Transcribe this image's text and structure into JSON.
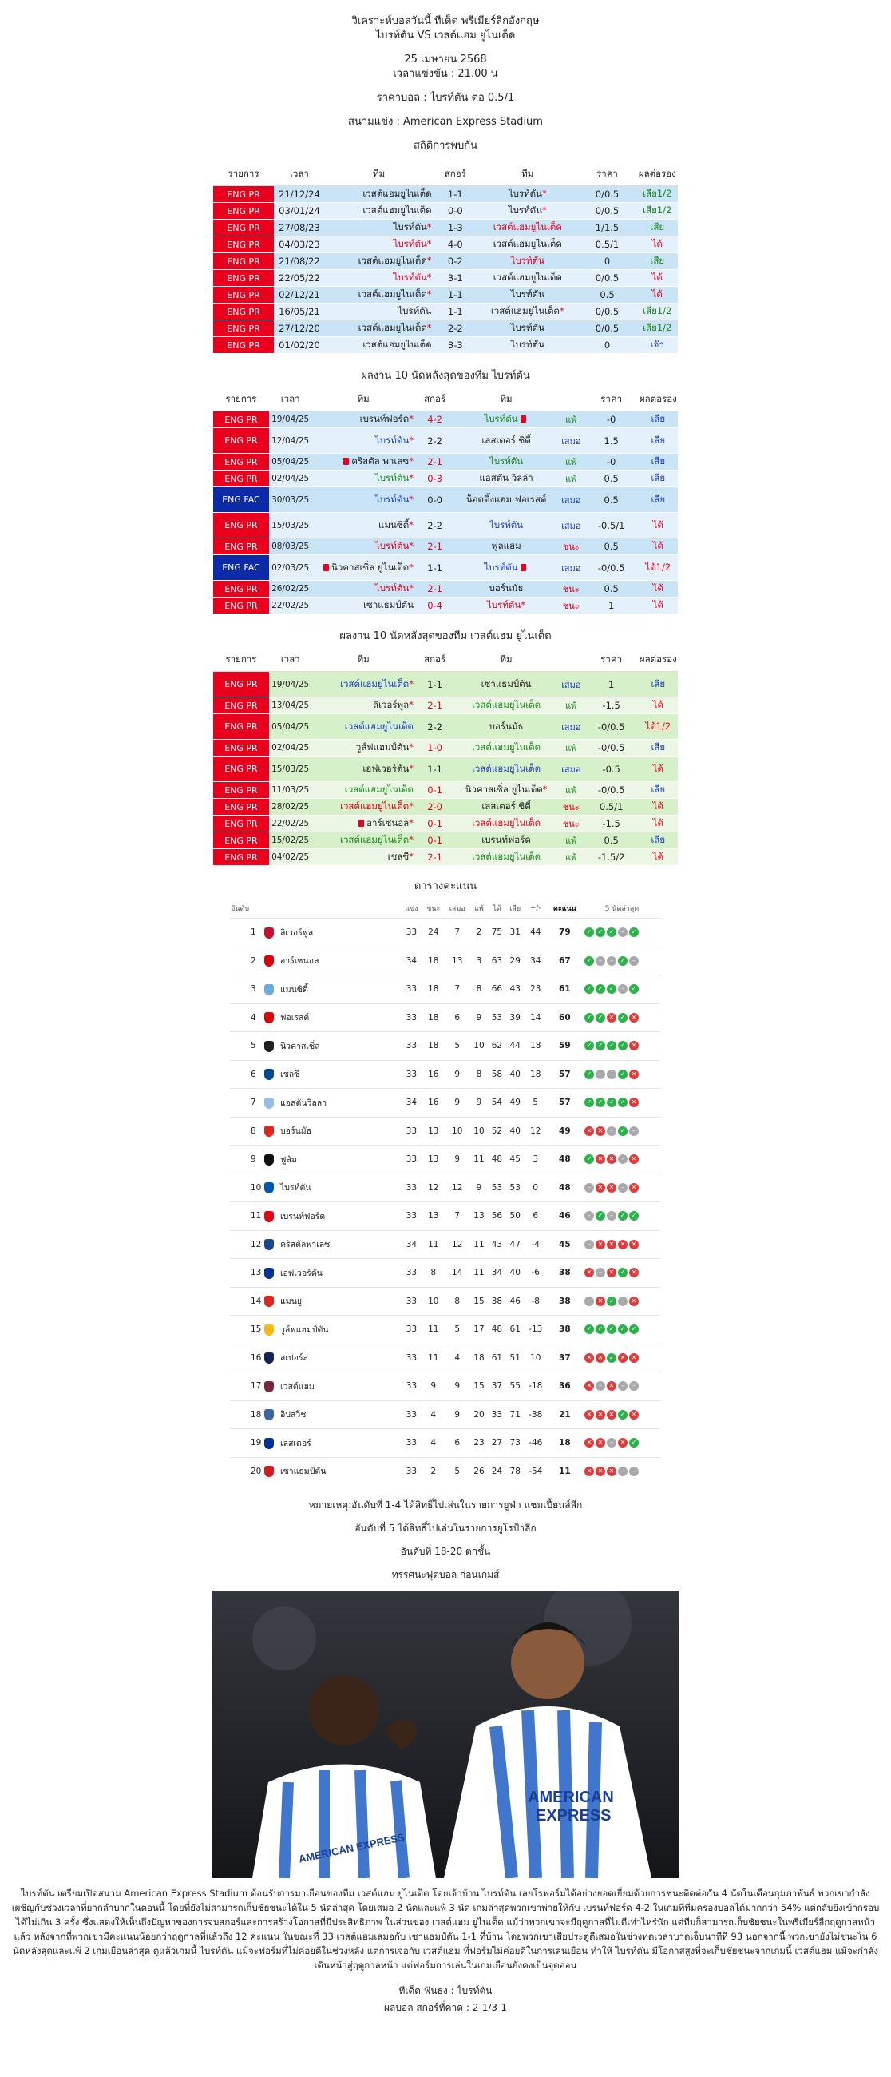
{
  "header": {
    "title1": "วิเคราะห์บอลวันนี้ ทีเด็ด พรีเมียร์ลีกอังกฤษ",
    "title2": "ไบรท์ตัน VS เวสต์แฮม ยูไนเต็ด",
    "date": "25 เมษายน 2568",
    "time": "เวลาแข่งขัน : 21.00 น",
    "odds": "ราคาบอล : ไบรท์ตัน ต่อ 0.5/1",
    "stadium": "สนามแข่ง : American Express Stadium",
    "h2h_title": "สถิติการพบกัน"
  },
  "cols": {
    "league": "รายการ",
    "date": "เวลา",
    "team": "ทีม",
    "score": "สกอร์",
    "price": "ราคา",
    "result": "ผลต่อรอง"
  },
  "h2h": [
    {
      "lg": "ENG PR",
      "d": "21/12/24",
      "h": "เวสต์แฮมยูไนเต็ด",
      "hs": "",
      "s": "1-1",
      "a": "ไบรท์ตัน",
      "as": "*",
      "hc": "",
      "ac": "",
      "p": "0/0.5",
      "r": "เสีย1/2",
      "rc": "green"
    },
    {
      "lg": "ENG PR",
      "d": "03/01/24",
      "h": "เวสต์แฮมยูไนเต็ด",
      "hs": "",
      "s": "0-0",
      "a": "ไบรท์ตัน",
      "as": "*",
      "hc": "",
      "ac": "",
      "p": "0/0.5",
      "r": "เสีย1/2",
      "rc": "green"
    },
    {
      "lg": "ENG PR",
      "d": "27/08/23",
      "h": "ไบรท์ตัน",
      "hs": "*",
      "s": "1-3",
      "a": "เวสต์แฮมยูไนเต็ด",
      "as": "",
      "hc": "",
      "ac": "red",
      "p": "1/1.5",
      "r": "เสีย",
      "rc": "green"
    },
    {
      "lg": "ENG PR",
      "d": "04/03/23",
      "h": "ไบรท์ตัน",
      "hs": "*",
      "s": "4-0",
      "a": "เวสต์แฮมยูไนเต็ด",
      "as": "",
      "hc": "red",
      "ac": "",
      "p": "0.5/1",
      "r": "ได้",
      "rc": "red"
    },
    {
      "lg": "ENG PR",
      "d": "21/08/22",
      "h": "เวสต์แฮมยูไนเต็ด",
      "hs": "*",
      "s": "0-2",
      "a": "ไบรท์ตัน",
      "as": "",
      "hc": "",
      "ac": "red",
      "p": "0",
      "r": "เสีย",
      "rc": "green"
    },
    {
      "lg": "ENG PR",
      "d": "22/05/22",
      "h": "ไบรท์ตัน",
      "hs": "*",
      "s": "3-1",
      "a": "เวสต์แฮมยูไนเต็ด",
      "as": "",
      "hc": "red",
      "ac": "",
      "p": "0/0.5",
      "r": "ได้",
      "rc": "red"
    },
    {
      "lg": "ENG PR",
      "d": "02/12/21",
      "h": "เวสต์แฮมยูไนเต็ด",
      "hs": "*",
      "s": "1-1",
      "a": "ไบรท์ตัน",
      "as": "",
      "hc": "",
      "ac": "",
      "p": "0.5",
      "r": "ได้",
      "rc": "red"
    },
    {
      "lg": "ENG PR",
      "d": "16/05/21",
      "h": "ไบรท์ตัน",
      "hs": "",
      "s": "1-1",
      "a": "เวสต์แฮมยูไนเต็ด",
      "as": "*",
      "hc": "",
      "ac": "",
      "p": "0/0.5",
      "r": "เสีย1/2",
      "rc": "green"
    },
    {
      "lg": "ENG PR",
      "d": "27/12/20",
      "h": "เวสต์แฮมยูไนเต็ด",
      "hs": "*",
      "s": "2-2",
      "a": "ไบรท์ตัน",
      "as": "",
      "hc": "",
      "ac": "",
      "p": "0/0.5",
      "r": "เสีย1/2",
      "rc": "green"
    },
    {
      "lg": "ENG PR",
      "d": "01/02/20",
      "h": "เวสต์แฮมยูไนเต็ด",
      "hs": "",
      "s": "3-3",
      "a": "ไบรท์ตัน",
      "as": "",
      "hc": "",
      "ac": "",
      "p": "0",
      "r": "เจ๊า",
      "rc": "blue"
    }
  ],
  "form1_title": "ผลงาน 10 นัดหลังสุดของทีม ไบรท์ตัน",
  "form1": [
    {
      "lg": "ENG PR",
      "d": "19/04/25",
      "h": "เบรนท์ฟอร์ด",
      "hs": "*",
      "s": "4-2",
      "a": "ไบรท์ตัน",
      "as": "",
      "card": "a",
      "hc": "",
      "ac": "green",
      "sc": "red",
      "wl": "แพ้",
      "wlc": "green",
      "p": "-0",
      "r": "เสีย",
      "rc": "blue"
    },
    {
      "lg": "ENG PR",
      "d": "12/04/25",
      "h": "ไบรท์ตัน",
      "hs": "*",
      "s": "2-2",
      "a": "เลสเตอร์ ซิตี้",
      "as": "",
      "card": "",
      "hc": "blue",
      "ac": "",
      "sc": "",
      "wl": "เสมอ",
      "wlc": "blue",
      "p": "1.5",
      "r": "เสีย",
      "rc": "blue"
    },
    {
      "lg": "ENG PR",
      "d": "05/04/25",
      "h": "คริสตัล พาเลซ",
      "hs": "*",
      "s": "2-1",
      "a": "ไบรท์ตัน",
      "as": "",
      "card": "h",
      "hc": "",
      "ac": "green",
      "sc": "red",
      "wl": "แพ้",
      "wlc": "green",
      "p": "-0",
      "r": "เสีย",
      "rc": "blue"
    },
    {
      "lg": "ENG PR",
      "d": "02/04/25",
      "h": "ไบรท์ตัน",
      "hs": "*",
      "s": "0-3",
      "a": "แอสตัน วิลล่า",
      "as": "",
      "card": "",
      "hc": "green",
      "ac": "",
      "sc": "red",
      "wl": "แพ้",
      "wlc": "green",
      "p": "0.5",
      "r": "เสีย",
      "rc": "blue"
    },
    {
      "lg": "ENG FAC",
      "d": "30/03/25",
      "h": "ไบรท์ตัน",
      "hs": "*",
      "s": "0-0",
      "a": "น็อตติ้งแฮม ฟอเรสต์",
      "as": "",
      "card": "",
      "hc": "blue",
      "ac": "",
      "sc": "",
      "wl": "เสมอ",
      "wlc": "blue",
      "p": "0.5",
      "r": "เสีย",
      "rc": "blue"
    },
    {
      "lg": "ENG PR",
      "d": "15/03/25",
      "h": "แมนซิตี้",
      "hs": "*",
      "s": "2-2",
      "a": "ไบรท์ตัน",
      "as": "",
      "card": "",
      "hc": "",
      "ac": "blue",
      "sc": "",
      "wl": "เสมอ",
      "wlc": "blue",
      "p": "-0.5/1",
      "r": "ได้",
      "rc": "red"
    },
    {
      "lg": "ENG PR",
      "d": "08/03/25",
      "h": "ไบรท์ตัน",
      "hs": "*",
      "s": "2-1",
      "a": "ฟูลแฮม",
      "as": "",
      "card": "",
      "hc": "red",
      "ac": "",
      "sc": "red",
      "wl": "ชนะ",
      "wlc": "red",
      "p": "0.5",
      "r": "ได้",
      "rc": "red"
    },
    {
      "lg": "ENG FAC",
      "d": "02/03/25",
      "h": "นิวคาสเซิ่ล ยูไนเต็ด",
      "hs": "*",
      "s": "1-1",
      "a": "ไบรท์ตัน",
      "as": "",
      "card": "both",
      "hc": "",
      "ac": "blue",
      "sc": "",
      "wl": "เสมอ",
      "wlc": "blue",
      "p": "-0/0.5",
      "r": "ได้1/2",
      "rc": "red"
    },
    {
      "lg": "ENG PR",
      "d": "26/02/25",
      "h": "ไบรท์ตัน",
      "hs": "*",
      "s": "2-1",
      "a": "บอร์นมัธ",
      "as": "",
      "card": "",
      "hc": "red",
      "ac": "",
      "sc": "red",
      "wl": "ชนะ",
      "wlc": "red",
      "p": "0.5",
      "r": "ได้",
      "rc": "red"
    },
    {
      "lg": "ENG PR",
      "d": "22/02/25",
      "h": "เซาแธมป์ตัน",
      "hs": "",
      "s": "0-4",
      "a": "ไบรท์ตัน",
      "as": "*",
      "card": "",
      "hc": "",
      "ac": "red",
      "sc": "red",
      "wl": "ชนะ",
      "wlc": "red",
      "p": "1",
      "r": "ได้",
      "rc": "red"
    }
  ],
  "form2_title": "ผลงาน 10 นัดหลังสุดของทีม เวสต์แฮม ยูไนเต็ด",
  "form2": [
    {
      "lg": "ENG PR",
      "d": "19/04/25",
      "h": "เวสต์แฮมยูไนเต็ด",
      "hs": "*",
      "s": "1-1",
      "a": "เซาแธมป์ตัน",
      "as": "",
      "card": "",
      "hc": "blue",
      "ac": "",
      "sc": "",
      "wl": "เสมอ",
      "wlc": "blue",
      "p": "1",
      "r": "เสีย",
      "rc": "blue"
    },
    {
      "lg": "ENG PR",
      "d": "13/04/25",
      "h": "ลิเวอร์พูล",
      "hs": "*",
      "s": "2-1",
      "a": "เวสต์แฮมยูไนเต็ด",
      "as": "",
      "card": "",
      "hc": "",
      "ac": "green",
      "sc": "red",
      "wl": "แพ้",
      "wlc": "green",
      "p": "-1.5",
      "r": "ได้",
      "rc": "red"
    },
    {
      "lg": "ENG PR",
      "d": "05/04/25",
      "h": "เวสต์แฮมยูไนเต็ด",
      "hs": "",
      "s": "2-2",
      "a": "บอร์นมัธ",
      "as": "",
      "card": "",
      "hc": "blue",
      "ac": "",
      "sc": "",
      "wl": "เสมอ",
      "wlc": "blue",
      "p": "-0/0.5",
      "r": "ได้1/2",
      "rc": "red"
    },
    {
      "lg": "ENG PR",
      "d": "02/04/25",
      "h": "วูล์ฟแฮมป์ตัน",
      "hs": "*",
      "s": "1-0",
      "a": "เวสต์แฮมยูไนเต็ด",
      "as": "",
      "card": "",
      "hc": "",
      "ac": "green",
      "sc": "red",
      "wl": "แพ้",
      "wlc": "green",
      "p": "-0/0.5",
      "r": "เสีย",
      "rc": "blue"
    },
    {
      "lg": "ENG PR",
      "d": "15/03/25",
      "h": "เอฟเวอร์ตัน",
      "hs": "*",
      "s": "1-1",
      "a": "เวสต์แฮมยูไนเต็ด",
      "as": "",
      "card": "",
      "hc": "",
      "ac": "blue",
      "sc": "",
      "wl": "เสมอ",
      "wlc": "blue",
      "p": "-0.5",
      "r": "ได้",
      "rc": "red"
    },
    {
      "lg": "ENG PR",
      "d": "11/03/25",
      "h": "เวสต์แฮมยูไนเต็ด",
      "hs": "",
      "s": "0-1",
      "a": "นิวคาสเซิ่ล ยูไนเต็ด",
      "as": "*",
      "card": "",
      "hc": "green",
      "ac": "",
      "sc": "red",
      "wl": "แพ้",
      "wlc": "green",
      "p": "-0/0.5",
      "r": "เสีย",
      "rc": "blue"
    },
    {
      "lg": "ENG PR",
      "d": "28/02/25",
      "h": "เวสต์แฮมยูไนเต็ด",
      "hs": "*",
      "s": "2-0",
      "a": "เลสเตอร์ ซิตี้",
      "as": "",
      "card": "",
      "hc": "red",
      "ac": "",
      "sc": "red",
      "wl": "ชนะ",
      "wlc": "red",
      "p": "0.5/1",
      "r": "ได้",
      "rc": "red"
    },
    {
      "lg": "ENG PR",
      "d": "22/02/25",
      "h": "อาร์เซนอล",
      "hs": "*",
      "s": "0-1",
      "a": "เวสต์แฮมยูไนเต็ด",
      "as": "",
      "card": "h",
      "hc": "",
      "ac": "red",
      "sc": "red",
      "wl": "ชนะ",
      "wlc": "red",
      "p": "-1.5",
      "r": "ได้",
      "rc": "red"
    },
    {
      "lg": "ENG PR",
      "d": "15/02/25",
      "h": "เวสต์แฮมยูไนเต็ด",
      "hs": "*",
      "s": "0-1",
      "a": "เบรนท์ฟอร์ด",
      "as": "",
      "card": "",
      "hc": "green",
      "ac": "",
      "sc": "red",
      "wl": "แพ้",
      "wlc": "green",
      "p": "0.5",
      "r": "เสีย",
      "rc": "blue"
    },
    {
      "lg": "ENG PR",
      "d": "04/02/25",
      "h": "เชลซี",
      "hs": "*",
      "s": "2-1",
      "a": "เวสต์แฮมยูไนเต็ด",
      "as": "",
      "card": "",
      "hc": "",
      "ac": "green",
      "sc": "red",
      "wl": "แพ้",
      "wlc": "green",
      "p": "-1.5/2",
      "r": "ได้",
      "rc": "red"
    }
  ],
  "standings_title": "ตารางคะแนน",
  "standings_cols": {
    "pos": "อันดับ",
    "pl": "แข่ง",
    "w": "ชนะ",
    "d": "เสมอ",
    "l": "แพ้",
    "gf": "ได้",
    "ga": "เสีย",
    "gd": "+/-",
    "pts": "คะแนน",
    "form": "5 นัดล่าสุด"
  },
  "standings": [
    {
      "pos": "1",
      "team": "ลิเวอร์พูล",
      "pl": "33",
      "w": "24",
      "d": "7",
      "l": "2",
      "gf": "75",
      "ga": "31",
      "gd": "44",
      "pts": "79",
      "c": "#c8102e",
      "form": "WWWDW"
    },
    {
      "pos": "2",
      "team": "อาร์เซนอล",
      "pl": "34",
      "w": "18",
      "d": "13",
      "l": "3",
      "gf": "63",
      "ga": "29",
      "gd": "34",
      "pts": "67",
      "c": "#db0007",
      "form": "WDDWD"
    },
    {
      "pos": "3",
      "team": "แมนซิตี้",
      "pl": "33",
      "w": "18",
      "d": "7",
      "l": "8",
      "gf": "66",
      "ga": "43",
      "gd": "23",
      "pts": "61",
      "c": "#6cabdd",
      "form": "WWWDW"
    },
    {
      "pos": "4",
      "team": "ฟอเรสต์",
      "pl": "33",
      "w": "18",
      "d": "6",
      "l": "9",
      "gf": "53",
      "ga": "39",
      "gd": "14",
      "pts": "60",
      "c": "#dd0000",
      "form": "WWLWL"
    },
    {
      "pos": "5",
      "team": "นิวคาสเซิ่ล",
      "pl": "33",
      "w": "18",
      "d": "5",
      "l": "10",
      "gf": "62",
      "ga": "44",
      "gd": "18",
      "pts": "59",
      "c": "#241f20",
      "form": "WWWWL"
    },
    {
      "pos": "6",
      "team": "เชลซี",
      "pl": "33",
      "w": "16",
      "d": "9",
      "l": "8",
      "gf": "58",
      "ga": "40",
      "gd": "18",
      "pts": "57",
      "c": "#034694",
      "form": "WDDWL"
    },
    {
      "pos": "7",
      "team": "แอสตันวิลลา",
      "pl": "34",
      "w": "16",
      "d": "9",
      "l": "9",
      "gf": "54",
      "ga": "49",
      "gd": "5",
      "pts": "57",
      "c": "#95bfe5",
      "form": "WWWWL"
    },
    {
      "pos": "8",
      "team": "บอร์นมัธ",
      "pl": "33",
      "w": "13",
      "d": "10",
      "l": "10",
      "gf": "52",
      "ga": "40",
      "gd": "12",
      "pts": "49",
      "c": "#da291c",
      "form": "LLDWD"
    },
    {
      "pos": "9",
      "team": "ฟูลัม",
      "pl": "33",
      "w": "13",
      "d": "9",
      "l": "11",
      "gf": "48",
      "ga": "45",
      "gd": "3",
      "pts": "48",
      "c": "#111111",
      "form": "WLLDL"
    },
    {
      "pos": "10",
      "team": "ไบรท์ตัน",
      "pl": "33",
      "w": "12",
      "d": "12",
      "l": "9",
      "gf": "53",
      "ga": "53",
      "gd": "0",
      "pts": "48",
      "c": "#0057b8",
      "form": "DLLDL"
    },
    {
      "pos": "11",
      "team": "เบรนท์ฟอร์ด",
      "pl": "33",
      "w": "13",
      "d": "7",
      "l": "13",
      "gf": "56",
      "ga": "50",
      "gd": "6",
      "pts": "46",
      "c": "#e30613",
      "form": "DWDWW"
    },
    {
      "pos": "12",
      "team": "คริสตัลพาเลซ",
      "pl": "34",
      "w": "11",
      "d": "12",
      "l": "11",
      "gf": "43",
      "ga": "47",
      "gd": "-4",
      "pts": "45",
      "c": "#1b458f",
      "form": "DLLLL"
    },
    {
      "pos": "13",
      "team": "เอฟเวอร์ตัน",
      "pl": "33",
      "w": "8",
      "d": "14",
      "l": "11",
      "gf": "34",
      "ga": "40",
      "gd": "-6",
      "pts": "38",
      "c": "#003399",
      "form": "LDLWL"
    },
    {
      "pos": "14",
      "team": "แมนยู",
      "pl": "33",
      "w": "10",
      "d": "8",
      "l": "15",
      "gf": "38",
      "ga": "46",
      "gd": "-8",
      "pts": "38",
      "c": "#da291c",
      "form": "DLWDL"
    },
    {
      "pos": "15",
      "team": "วูล์ฟแฮมป์ตัน",
      "pl": "33",
      "w": "11",
      "d": "5",
      "l": "17",
      "gf": "48",
      "ga": "61",
      "gd": "-13",
      "pts": "38",
      "c": "#fdb913",
      "form": "WWWWW"
    },
    {
      "pos": "16",
      "team": "สเปอร์ส",
      "pl": "33",
      "w": "11",
      "d": "4",
      "l": "18",
      "gf": "61",
      "ga": "51",
      "gd": "10",
      "pts": "37",
      "c": "#132257",
      "form": "LLWLL"
    },
    {
      "pos": "17",
      "team": "เวสต์แฮม",
      "pl": "33",
      "w": "9",
      "d": "9",
      "l": "15",
      "gf": "37",
      "ga": "55",
      "gd": "-18",
      "pts": "36",
      "c": "#7a263a",
      "form": "LDLDD"
    },
    {
      "pos": "18",
      "team": "อิปสวิช",
      "pl": "33",
      "w": "4",
      "d": "9",
      "l": "20",
      "gf": "33",
      "ga": "71",
      "gd": "-38",
      "pts": "21",
      "c": "#3a64a3",
      "form": "LLLWL"
    },
    {
      "pos": "19",
      "team": "เลสเตอร์",
      "pl": "33",
      "w": "4",
      "d": "6",
      "l": "23",
      "gf": "27",
      "ga": "73",
      "gd": "-46",
      "pts": "18",
      "c": "#003090",
      "form": "LLDLW"
    },
    {
      "pos": "20",
      "team": "เซาแธมป์ตัน",
      "pl": "33",
      "w": "2",
      "d": "5",
      "l": "26",
      "gf": "24",
      "ga": "78",
      "gd": "-54",
      "pts": "11",
      "c": "#d71920",
      "form": "LLLDD"
    }
  ],
  "notes": {
    "n1": "หมายเหตุ:อันดับที่ 1-4 ได้สิทธิ์ไปเล่นในรายการยูฟ่า แชมเปี้ยนส์ลีก",
    "n2": "อันดับที่ 5 ได้สิทธิ์ไปเล่นในรายการยูโรป้าลีก",
    "n3": "อันดับที่ 18-20 ตกชั้น",
    "preview": "ทรรศนะฟุตบอล ก่อนเกมส์"
  },
  "photo": {
    "shirt_text1": "AMERICAN",
    "shirt_text2": "EXPRESS",
    "shirt_text3": "AMERICAN EXPRESS"
  },
  "analysis": "ไบรท์ตัน เตรียมเปิดสนาม American Express Stadium ต้อนรับการมาเยือนของทีม เวสต์แฮม ยูไนเต็ด โดยเจ้าบ้าน ไบรท์ตัน เลยโรฟอร์มได้อย่างยอดเยี่ยมด้วยการชนะติดต่อกัน 4 นัดในเดือนกุมภาพันธ์ พวกเขากำลังเผชิญกับช่วงเวลาที่ยากลำบากในตอนนี้ โดยที่ยังไม่สามารถเก็บชัยชนะได้ใน 5 นัดล่าสุด โดยเสมอ 2 นัดและแพ้ 3 นัด เกมล่าสุดพวกเขาพ่ายให้กับ เบรนท์ฟอร์ด 4-2 ในเกมที่ทีมครองบอลได้มากกว่า 54% แต่กลับยิงเข้ากรอบได้ไม่เกิน 3 ครั้ง ซึ่งแสดงให้เห็นถึงปัญหาของการจบสกอร์และการสร้างโอกาสที่มีประสิทธิภาพ ในส่วนของ เวสต์แฮม ยูไนเต็ด แม้ว่าพวกเขาจะมีฤดูกาลที่ไม่ดีเท่าไหร่นัก แต่ทีมก็สามารถเก็บชัยชนะในพรีเมียร์ลีกฤดูกาลหน้าแล้ว หลังจากที่พวกเขามีคะแนนน้อยกว่าฤดูกาลที่แล้วถึง 12 คะแนน ในขณะที่ 33 เวสต์แฮมเสมอกับ เซาแธมป์ตัน 1-1 ที่บ้าน โดยพวกเขาเสียประตูตีเสมอในช่วงทดเวลาบาดเจ็บนาทีที่ 93 นอกจากนี้ พวกเขายังไม่ชนะใน 6 นัดหลังสุดและแพ้ 2 เกมเยือนล่าสุด ดูแล้วเกมนี้ ไบรท์ตัน แม้จะฟอร์มที่ไม่ค่อยดีในช่วงหลัง แต่การเจอกับ เวสต์แฮม ที่ฟอร์มไม่ค่อยดีในการเล่นเยือน ทำให้ ไบรท์ตัน มีโอกาสสูงที่จะเก็บชัยชนะจากเกมนี้ เวสต์แฮม แม้จะกำลังเดินหน้าสู่ฤดูกาลหน้า แต่ฟอร์มการเล่นในเกมเยือนยังคงเป็นจุดอ่อน",
  "pick": "ทีเด็ด ฟันธง : ไบรท์ตัน",
  "score_pred": "ผลบอล สกอร์ที่คาด : 2-1/3-1"
}
